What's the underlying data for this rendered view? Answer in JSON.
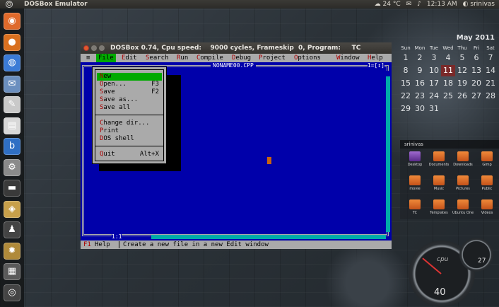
{
  "top_panel": {
    "app_title": "DOSBox Emulator",
    "weather": "24 °C",
    "time": "12:13 AM",
    "user": "srinivas"
  },
  "launcher": {
    "items": [
      {
        "name": "dash-icon",
        "glyph": "◉",
        "color": "#e06a2b"
      },
      {
        "name": "firefox-icon",
        "glyph": "●",
        "color": "#d9701f"
      },
      {
        "name": "chromium-icon",
        "glyph": "◍",
        "color": "#3b7bd6"
      },
      {
        "name": "thunderbird-icon",
        "glyph": "✉",
        "color": "#6b8fbf"
      },
      {
        "name": "text-editor-icon",
        "glyph": "✎",
        "color": "#c9c9c9"
      },
      {
        "name": "document-icon",
        "glyph": "▤",
        "color": "#d8d8d8"
      },
      {
        "name": "backup-icon",
        "glyph": "b",
        "color": "#2f6fc4"
      },
      {
        "name": "settings-icon",
        "glyph": "⚙",
        "color": "#8a8a8a"
      },
      {
        "name": "terminal-icon",
        "glyph": "▬",
        "color": "#3a3a3a"
      },
      {
        "name": "package-icon",
        "glyph": "◈",
        "color": "#c8a04a"
      },
      {
        "name": "tux-icon",
        "glyph": "♟",
        "color": "#444"
      },
      {
        "name": "dosbox-icon",
        "glyph": "✹",
        "color": "#b08a3a"
      },
      {
        "name": "screen-icon",
        "glyph": "▦",
        "color": "#5a5a5a"
      },
      {
        "name": "system-icon",
        "glyph": "◎",
        "color": "#444"
      }
    ]
  },
  "calendar": {
    "title": "May 2011",
    "days": [
      "Sun",
      "Mon",
      "Tue",
      "Wed",
      "Thu",
      "Fri",
      "Sat"
    ],
    "dates": [
      "1",
      "2",
      "3",
      "4",
      "5",
      "6",
      "7",
      "8",
      "9",
      "10",
      "11",
      "12",
      "13",
      "14",
      "15",
      "16",
      "17",
      "18",
      "19",
      "20",
      "21",
      "22",
      "23",
      "24",
      "25",
      "26",
      "27",
      "28",
      "29",
      "30",
      "31"
    ],
    "today": "11"
  },
  "folder_widget": {
    "title": "srinivas",
    "items": [
      "Desktop",
      "Documents",
      "Downloads",
      "Gimp",
      "movie",
      "Music",
      "Pictures",
      "Public",
      "TC",
      "Templates",
      "Ubuntu One",
      "Videos"
    ]
  },
  "gauges": {
    "cpu_label": "cpu",
    "cpu_value": "40",
    "small_value": "27"
  },
  "dosbox": {
    "title": "DOSBox 0.74, Cpu speed:    9000 cycles, Frameskip  0, Program:     TC",
    "menu": {
      "system": "≡",
      "file": "File",
      "edit": "Edit",
      "search": "Search",
      "run": "Run",
      "compile": "Compile",
      "debug": "Debug",
      "project": "Project",
      "options": "Options",
      "window": "Window",
      "help": "Help"
    },
    "editor": {
      "filename": "NONAME00.CPP",
      "window_number": "1=[↕]",
      "position": "1:1"
    },
    "file_menu": [
      {
        "label": "New",
        "key": "",
        "selected": true
      },
      {
        "label": "Open...",
        "key": "F3"
      },
      {
        "label": "Save",
        "key": "F2"
      },
      {
        "label": "Save as...",
        "key": ""
      },
      {
        "label": "Save all",
        "key": ""
      },
      {
        "label": "Change dir...",
        "key": ""
      },
      {
        "label": "Print",
        "key": ""
      },
      {
        "label": "DOS shell",
        "key": ""
      },
      {
        "label": "Quit",
        "key": "Alt+X"
      }
    ],
    "status": {
      "f1": "F1",
      "help": "Help",
      "message": "Create a new file in a new Edit window"
    }
  }
}
